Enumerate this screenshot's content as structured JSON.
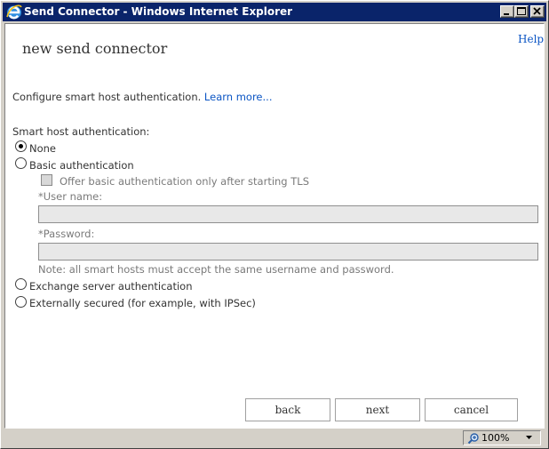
{
  "window": {
    "title": "Send Connector - Windows Internet Explorer",
    "icon": "ie-icon",
    "controls": [
      "minimize-icon",
      "maximize-icon",
      "close-icon"
    ]
  },
  "page": {
    "title": "new send connector",
    "help_label": "Help",
    "intro_text": "Configure smart host authentication.",
    "learn_more_label": "Learn more..."
  },
  "auth": {
    "label": "Smart host authentication:",
    "options": {
      "none": "None",
      "basic": "Basic authentication",
      "exchange": "Exchange server authentication",
      "external": "Externally secured (for example, with IPSec)"
    },
    "selected": "none",
    "tls_checkbox_label": "Offer basic authentication only after starting TLS",
    "tls_checked": false,
    "username_label": "*User name:",
    "username_value": "",
    "password_label": "*Password:",
    "password_value": "",
    "note": "Note: all smart hosts must accept the same username and password."
  },
  "buttons": {
    "back": "back",
    "next": "next",
    "cancel": "cancel"
  },
  "status": {
    "zoom": "100%"
  },
  "colors": {
    "titlebar": "#0a246a",
    "link": "#0b55c4",
    "chrome": "#d4d0c8"
  }
}
